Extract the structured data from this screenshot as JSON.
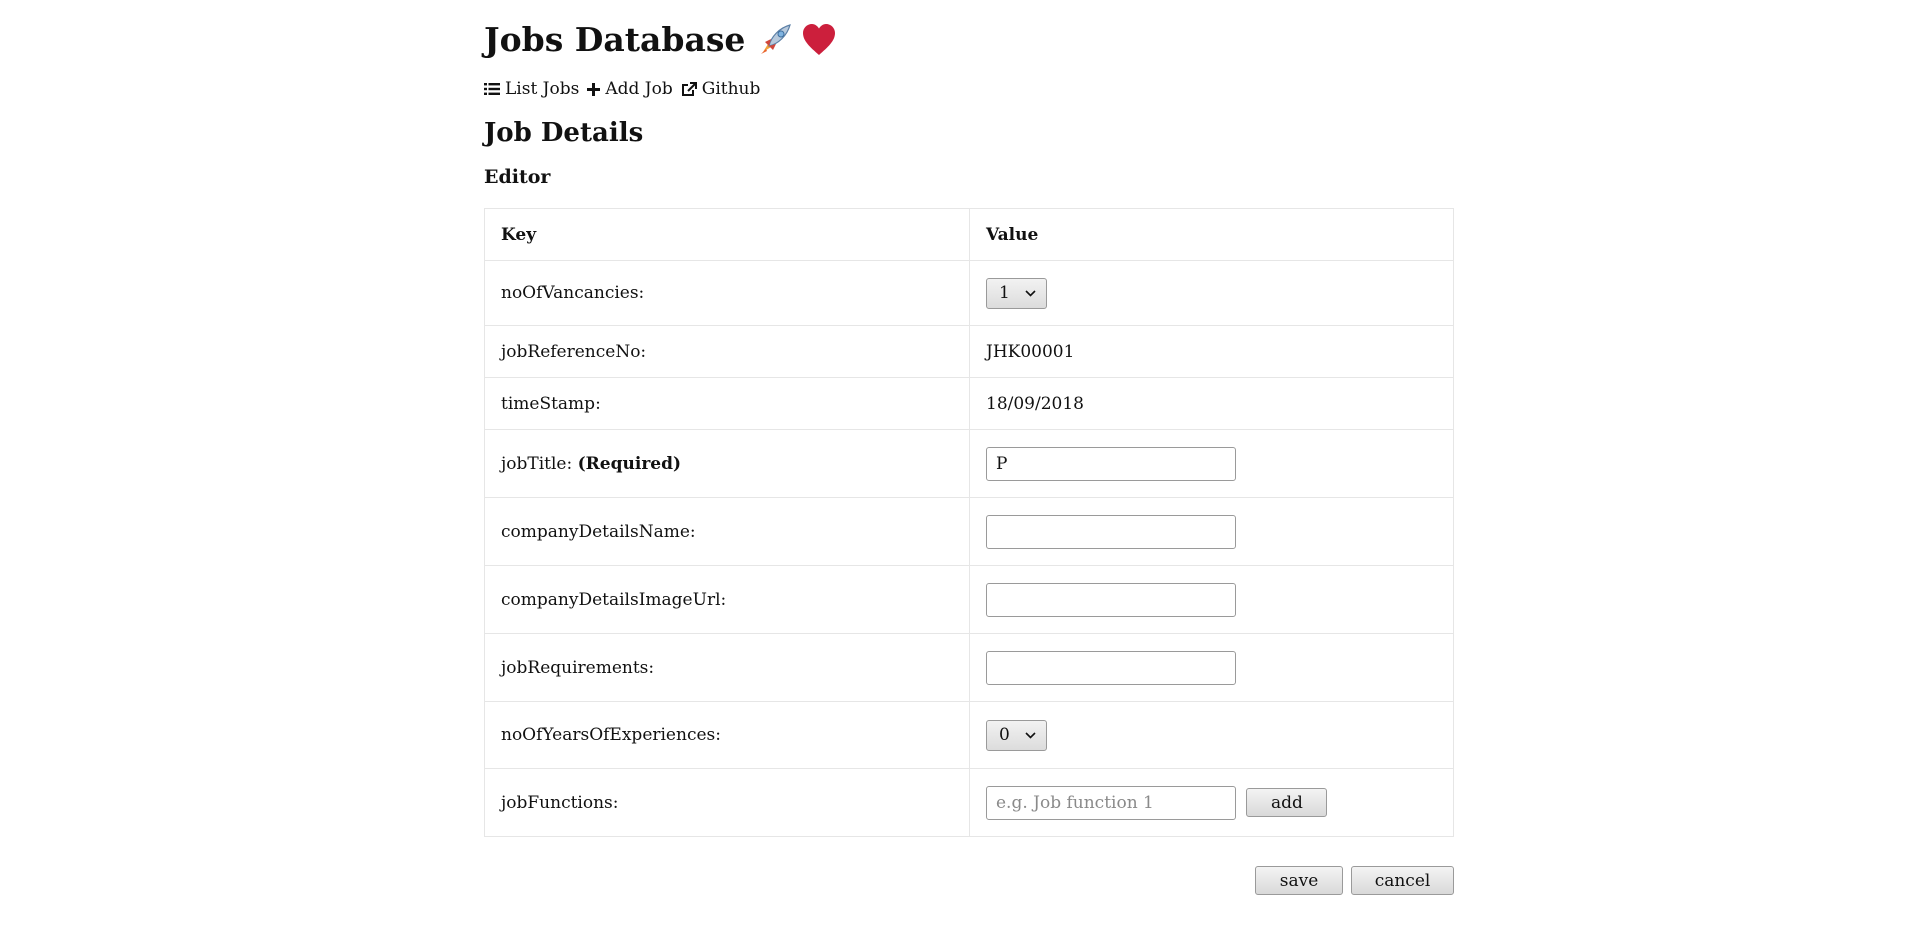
{
  "header": {
    "title": "Jobs Database",
    "title_icons": [
      "rocket-icon",
      "heart-icon"
    ]
  },
  "nav": {
    "items": [
      {
        "label": "List Jobs",
        "icon": "list-icon"
      },
      {
        "label": "Add Job",
        "icon": "plus-icon"
      },
      {
        "label": "Github",
        "icon": "external-link-icon"
      }
    ]
  },
  "page": {
    "heading": "Job Details",
    "subheading": "Editor"
  },
  "table": {
    "headers": {
      "key": "Key",
      "value": "Value"
    },
    "rows": {
      "noOfVancancies": {
        "label": "noOfVancancies:",
        "value": "1"
      },
      "jobReferenceNo": {
        "label": "jobReferenceNo:",
        "value": "JHK00001"
      },
      "timeStamp": {
        "label": "timeStamp:",
        "value": "18/09/2018"
      },
      "jobTitle": {
        "label": "jobTitle:",
        "required": "(Required)",
        "value": "P"
      },
      "companyDetailsName": {
        "label": "companyDetailsName:",
        "value": ""
      },
      "companyDetailsImageUrl": {
        "label": "companyDetailsImageUrl:",
        "value": ""
      },
      "jobRequirements": {
        "label": "jobRequirements:",
        "value": ""
      },
      "noOfYearsOfExperiences": {
        "label": "noOfYearsOfExperiences:",
        "value": "0"
      },
      "jobFunctions": {
        "label": "jobFunctions:",
        "placeholder": "e.g. Job function 1",
        "value": "",
        "add_label": "add"
      }
    }
  },
  "actions": {
    "save_label": "save",
    "cancel_label": "cancel"
  },
  "colors": {
    "heart": "#cc1f3c",
    "rocket_body": "#7fb3e0",
    "rocket_flame": "#f2a23a"
  }
}
